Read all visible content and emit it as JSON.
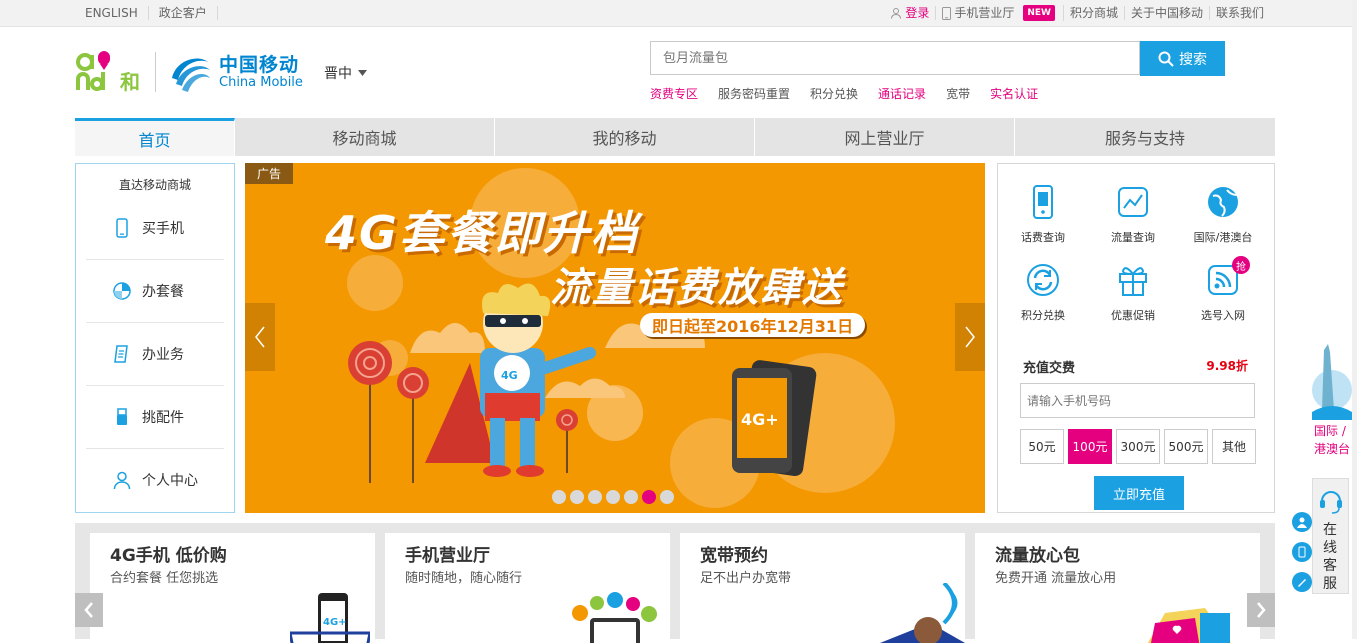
{
  "topbar": {
    "left": [
      "ENGLISH",
      "政企客户"
    ],
    "login": "登录",
    "mobile_hall": "手机营业厅",
    "new_badge": "NEW",
    "points_mall": "积分商城",
    "about": "关于中国移动",
    "contact": "联系我们"
  },
  "header": {
    "and_logo_text": "和",
    "cm_name_cn": "中国移动",
    "cm_name_en": "China Mobile",
    "region": "晋中",
    "search_placeholder": "包月流量包",
    "search_button": "搜索",
    "hot_links": [
      {
        "label": "资费专区",
        "highlight": true
      },
      {
        "label": "服务密码重置",
        "highlight": false
      },
      {
        "label": "积分兑换",
        "highlight": false
      },
      {
        "label": "通话记录",
        "highlight": true
      },
      {
        "label": "宽带",
        "highlight": false
      },
      {
        "label": "实名认证",
        "highlight": true
      }
    ]
  },
  "nav": {
    "tabs": [
      "首页",
      "移动商城",
      "我的移动",
      "网上营业厅",
      "服务与支持"
    ],
    "active_index": 0
  },
  "left_panel": {
    "title": "直达移动商城",
    "items": [
      {
        "label": "买手机",
        "icon": "phone-icon"
      },
      {
        "label": "办套餐",
        "icon": "plan-icon"
      },
      {
        "label": "办业务",
        "icon": "document-icon"
      },
      {
        "label": "挑配件",
        "icon": "usb-icon"
      },
      {
        "label": "个人中心",
        "icon": "user-icon"
      }
    ]
  },
  "banner": {
    "ad_label": "广告",
    "headline": "4G套餐即升档",
    "subline": "流量话费放肆送",
    "date_text": "即日起至2016年12月31日",
    "badge_text": "4G+",
    "dots_count": 7,
    "active_dot": 5,
    "colors": {
      "background": "#f39800",
      "accent": "#e4007f"
    }
  },
  "right_panel": {
    "services": [
      {
        "label": "话费查询",
        "icon": "phone-bill-icon"
      },
      {
        "label": "流量查询",
        "icon": "traffic-chart-icon"
      },
      {
        "label": "国际/港澳台",
        "icon": "globe-icon"
      },
      {
        "label": "积分兑换",
        "icon": "exchange-icon"
      },
      {
        "label": "优惠促销",
        "icon": "gift-icon"
      },
      {
        "label": "选号入网",
        "icon": "sim-icon"
      }
    ],
    "grab_badge": "抢",
    "recharge_title": "充值交费",
    "discount": "9.98折",
    "phone_placeholder": "请输入手机号码",
    "amounts": [
      "50元",
      "100元",
      "300元",
      "500元",
      "其他"
    ],
    "selected_amount": 1,
    "recharge_button": "立即充值"
  },
  "promos": [
    {
      "title": "4G手机 低价购",
      "subtitle": "合约套餐 任您挑选"
    },
    {
      "title": "手机营业厅",
      "subtitle": "随时随地，随心随行"
    },
    {
      "title": "宽带预约",
      "subtitle": "足不出户办宽带"
    },
    {
      "title": "流量放心包",
      "subtitle": "免费开通 流量放心用"
    }
  ],
  "floating": {
    "intl_line1": "国际 /",
    "intl_line2": "港澳台",
    "customer_service": "在线客服"
  },
  "colors": {
    "brand_blue": "#1ba1e2",
    "brand_pink": "#e4007f",
    "and_green": "#8cc63f"
  }
}
